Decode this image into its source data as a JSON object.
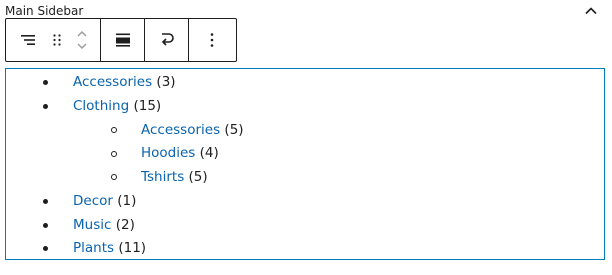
{
  "panel": {
    "title": "Main Sidebar",
    "collapse_icon": "chevron-up-icon"
  },
  "toolbar": {
    "groups": [
      [
        "parent-selector-icon",
        "drag-handle-icon",
        "move-up-down-icon"
      ],
      [
        "align-icon"
      ],
      [
        "transform-icon"
      ],
      [
        "more-options-icon"
      ]
    ]
  },
  "categories": {
    "accessories": {
      "label": "Accessories",
      "count": "(3)"
    },
    "clothing": {
      "label": "Clothing",
      "count": "(15)"
    },
    "clothing_accessories": {
      "label": "Accessories",
      "count": "(5)"
    },
    "clothing_hoodies": {
      "label": "Hoodies",
      "count": "(4)"
    },
    "clothing_tshirts": {
      "label": "Tshirts",
      "count": "(5)"
    },
    "decor": {
      "label": "Decor",
      "count": "(1)"
    },
    "music": {
      "label": "Music",
      "count": "(2)"
    },
    "plants": {
      "label": "Plants",
      "count": "(11)"
    }
  }
}
